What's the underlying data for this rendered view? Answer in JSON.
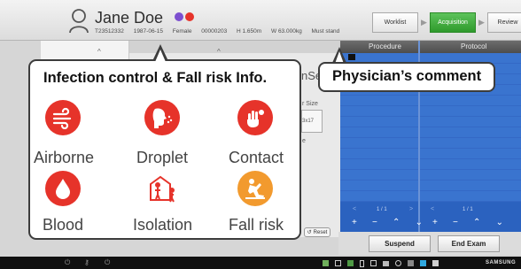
{
  "patient": {
    "name": "Jane Doe",
    "id": "T23512332",
    "dob": "1987-06-15",
    "sex": "Female",
    "accession": "00000203",
    "height": "H 1.650m",
    "weight": "W 63.000kg",
    "comment": "Must stand"
  },
  "workflow": {
    "worklist": "Worklist",
    "acquisition": "Acquisition",
    "review": "Review"
  },
  "procedure_panel": {
    "procedure_header": "Procedure",
    "protocol_header": "Protocol",
    "pager_left": "1 / 1",
    "pager_right": "1 / 1"
  },
  "left_panel": {
    "partial_tab": "nSe",
    "partial_size": "r Size",
    "partial_dim": "3x17",
    "partial_e": "e",
    "reset_label": "Reset"
  },
  "actions": {
    "suspend": "Suspend",
    "end_exam": "End Exam"
  },
  "infection_popup": {
    "title": "Infection control & Fall risk Info.",
    "items": [
      {
        "label": "Airborne",
        "icon": "airborne-icon",
        "color": "#e6332a"
      },
      {
        "label": "Droplet",
        "icon": "droplet-icon",
        "color": "#e6332a"
      },
      {
        "label": "Contact",
        "icon": "contact-icon",
        "color": "#e6332a"
      },
      {
        "label": "Blood",
        "icon": "blood-icon",
        "color": "#e6332a"
      },
      {
        "label": "Isolation",
        "icon": "isolation-icon",
        "color": "#e6332a"
      },
      {
        "label": "Fall risk",
        "icon": "fall-risk-icon",
        "color": "#f29a2e"
      }
    ]
  },
  "physician_callout": {
    "title": "Physician’s comment"
  },
  "taskbar": {
    "brand": "SAMSUNG"
  },
  "colors": {
    "accent_green": "#3aa838",
    "panel_blue": "#2b62bf",
    "infection_red": "#e6332a",
    "fall_orange": "#f29a2e"
  }
}
